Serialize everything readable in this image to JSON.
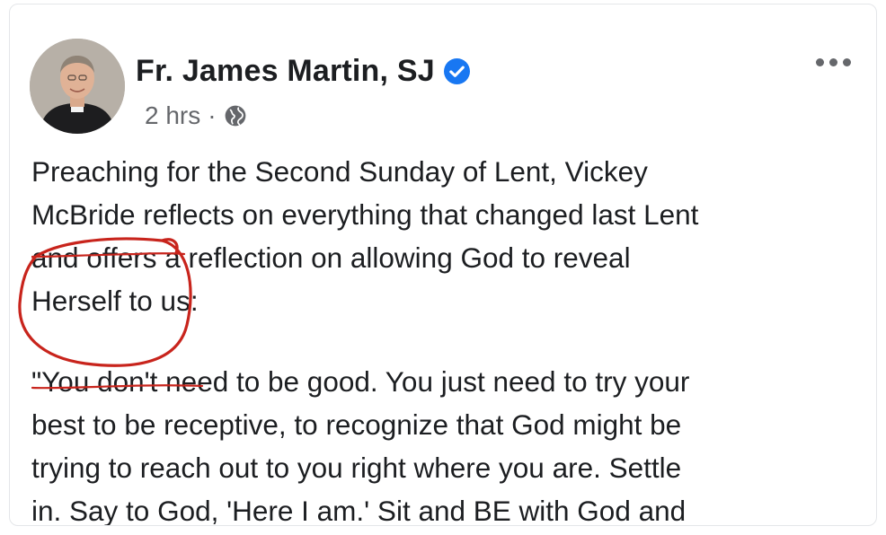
{
  "post": {
    "author": "Fr. James Martin, SJ",
    "timestamp": "2 hrs",
    "separator": "·",
    "audience_icon": "globe-icon",
    "verified_icon": "verified-badge-icon",
    "more_icon": "more-options-icon",
    "paragraphs": [
      "Preaching for the Second Sunday of Lent, Vickey\nMcBride reflects on everything that changed last Lent\nand offers a reflection on allowing God to reveal\nHerself to us:",
      "\"You don't need to be good. You just need to try your\nbest to be receptive, to recognize that God might be\ntrying to reach out to you right where you are. Settle\nin. Say to God, 'Here I am.' Sit and BE with God and"
    ]
  },
  "colors": {
    "verified": "#1877f2",
    "meta_text": "#65676b",
    "annotation": "#c8241c"
  }
}
